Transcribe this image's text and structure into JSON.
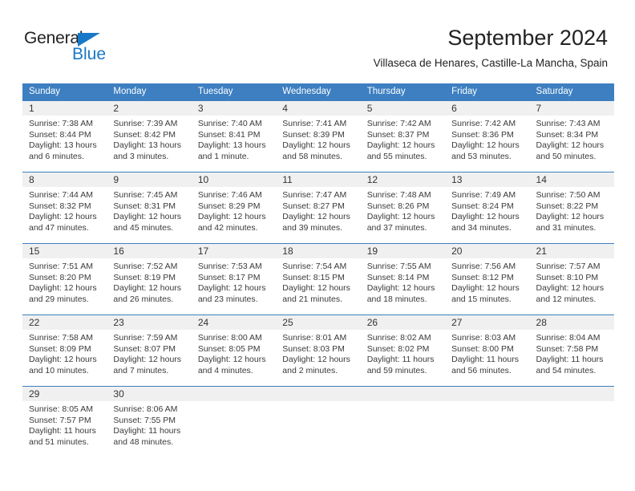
{
  "brand": {
    "name_part1": "General",
    "name_part2": "Blue",
    "triangle_color": "#1878c8",
    "text_color": "#222222"
  },
  "header": {
    "month_title": "September 2024",
    "location": "Villaseca de Henares, Castille-La Mancha, Spain"
  },
  "theme": {
    "header_blue": "#3d7fc1",
    "daynum_background": "#f0f0f0",
    "cell_text": "#3a3a3a"
  },
  "calendar": {
    "weekday_headers": [
      "Sunday",
      "Monday",
      "Tuesday",
      "Wednesday",
      "Thursday",
      "Friday",
      "Saturday"
    ],
    "weeks": [
      [
        {
          "day": "1",
          "sunrise": "Sunrise: 7:38 AM",
          "sunset": "Sunset: 8:44 PM",
          "daylight1": "Daylight: 13 hours",
          "daylight2": "and 6 minutes."
        },
        {
          "day": "2",
          "sunrise": "Sunrise: 7:39 AM",
          "sunset": "Sunset: 8:42 PM",
          "daylight1": "Daylight: 13 hours",
          "daylight2": "and 3 minutes."
        },
        {
          "day": "3",
          "sunrise": "Sunrise: 7:40 AM",
          "sunset": "Sunset: 8:41 PM",
          "daylight1": "Daylight: 13 hours",
          "daylight2": "and 1 minute."
        },
        {
          "day": "4",
          "sunrise": "Sunrise: 7:41 AM",
          "sunset": "Sunset: 8:39 PM",
          "daylight1": "Daylight: 12 hours",
          "daylight2": "and 58 minutes."
        },
        {
          "day": "5",
          "sunrise": "Sunrise: 7:42 AM",
          "sunset": "Sunset: 8:37 PM",
          "daylight1": "Daylight: 12 hours",
          "daylight2": "and 55 minutes."
        },
        {
          "day": "6",
          "sunrise": "Sunrise: 7:42 AM",
          "sunset": "Sunset: 8:36 PM",
          "daylight1": "Daylight: 12 hours",
          "daylight2": "and 53 minutes."
        },
        {
          "day": "7",
          "sunrise": "Sunrise: 7:43 AM",
          "sunset": "Sunset: 8:34 PM",
          "daylight1": "Daylight: 12 hours",
          "daylight2": "and 50 minutes."
        }
      ],
      [
        {
          "day": "8",
          "sunrise": "Sunrise: 7:44 AM",
          "sunset": "Sunset: 8:32 PM",
          "daylight1": "Daylight: 12 hours",
          "daylight2": "and 47 minutes."
        },
        {
          "day": "9",
          "sunrise": "Sunrise: 7:45 AM",
          "sunset": "Sunset: 8:31 PM",
          "daylight1": "Daylight: 12 hours",
          "daylight2": "and 45 minutes."
        },
        {
          "day": "10",
          "sunrise": "Sunrise: 7:46 AM",
          "sunset": "Sunset: 8:29 PM",
          "daylight1": "Daylight: 12 hours",
          "daylight2": "and 42 minutes."
        },
        {
          "day": "11",
          "sunrise": "Sunrise: 7:47 AM",
          "sunset": "Sunset: 8:27 PM",
          "daylight1": "Daylight: 12 hours",
          "daylight2": "and 39 minutes."
        },
        {
          "day": "12",
          "sunrise": "Sunrise: 7:48 AM",
          "sunset": "Sunset: 8:26 PM",
          "daylight1": "Daylight: 12 hours",
          "daylight2": "and 37 minutes."
        },
        {
          "day": "13",
          "sunrise": "Sunrise: 7:49 AM",
          "sunset": "Sunset: 8:24 PM",
          "daylight1": "Daylight: 12 hours",
          "daylight2": "and 34 minutes."
        },
        {
          "day": "14",
          "sunrise": "Sunrise: 7:50 AM",
          "sunset": "Sunset: 8:22 PM",
          "daylight1": "Daylight: 12 hours",
          "daylight2": "and 31 minutes."
        }
      ],
      [
        {
          "day": "15",
          "sunrise": "Sunrise: 7:51 AM",
          "sunset": "Sunset: 8:20 PM",
          "daylight1": "Daylight: 12 hours",
          "daylight2": "and 29 minutes."
        },
        {
          "day": "16",
          "sunrise": "Sunrise: 7:52 AM",
          "sunset": "Sunset: 8:19 PM",
          "daylight1": "Daylight: 12 hours",
          "daylight2": "and 26 minutes."
        },
        {
          "day": "17",
          "sunrise": "Sunrise: 7:53 AM",
          "sunset": "Sunset: 8:17 PM",
          "daylight1": "Daylight: 12 hours",
          "daylight2": "and 23 minutes."
        },
        {
          "day": "18",
          "sunrise": "Sunrise: 7:54 AM",
          "sunset": "Sunset: 8:15 PM",
          "daylight1": "Daylight: 12 hours",
          "daylight2": "and 21 minutes."
        },
        {
          "day": "19",
          "sunrise": "Sunrise: 7:55 AM",
          "sunset": "Sunset: 8:14 PM",
          "daylight1": "Daylight: 12 hours",
          "daylight2": "and 18 minutes."
        },
        {
          "day": "20",
          "sunrise": "Sunrise: 7:56 AM",
          "sunset": "Sunset: 8:12 PM",
          "daylight1": "Daylight: 12 hours",
          "daylight2": "and 15 minutes."
        },
        {
          "day": "21",
          "sunrise": "Sunrise: 7:57 AM",
          "sunset": "Sunset: 8:10 PM",
          "daylight1": "Daylight: 12 hours",
          "daylight2": "and 12 minutes."
        }
      ],
      [
        {
          "day": "22",
          "sunrise": "Sunrise: 7:58 AM",
          "sunset": "Sunset: 8:09 PM",
          "daylight1": "Daylight: 12 hours",
          "daylight2": "and 10 minutes."
        },
        {
          "day": "23",
          "sunrise": "Sunrise: 7:59 AM",
          "sunset": "Sunset: 8:07 PM",
          "daylight1": "Daylight: 12 hours",
          "daylight2": "and 7 minutes."
        },
        {
          "day": "24",
          "sunrise": "Sunrise: 8:00 AM",
          "sunset": "Sunset: 8:05 PM",
          "daylight1": "Daylight: 12 hours",
          "daylight2": "and 4 minutes."
        },
        {
          "day": "25",
          "sunrise": "Sunrise: 8:01 AM",
          "sunset": "Sunset: 8:03 PM",
          "daylight1": "Daylight: 12 hours",
          "daylight2": "and 2 minutes."
        },
        {
          "day": "26",
          "sunrise": "Sunrise: 8:02 AM",
          "sunset": "Sunset: 8:02 PM",
          "daylight1": "Daylight: 11 hours",
          "daylight2": "and 59 minutes."
        },
        {
          "day": "27",
          "sunrise": "Sunrise: 8:03 AM",
          "sunset": "Sunset: 8:00 PM",
          "daylight1": "Daylight: 11 hours",
          "daylight2": "and 56 minutes."
        },
        {
          "day": "28",
          "sunrise": "Sunrise: 8:04 AM",
          "sunset": "Sunset: 7:58 PM",
          "daylight1": "Daylight: 11 hours",
          "daylight2": "and 54 minutes."
        }
      ],
      [
        {
          "day": "29",
          "sunrise": "Sunrise: 8:05 AM",
          "sunset": "Sunset: 7:57 PM",
          "daylight1": "Daylight: 11 hours",
          "daylight2": "and 51 minutes."
        },
        {
          "day": "30",
          "sunrise": "Sunrise: 8:06 AM",
          "sunset": "Sunset: 7:55 PM",
          "daylight1": "Daylight: 11 hours",
          "daylight2": "and 48 minutes."
        },
        {
          "day": "",
          "sunrise": "",
          "sunset": "",
          "daylight1": "",
          "daylight2": ""
        },
        {
          "day": "",
          "sunrise": "",
          "sunset": "",
          "daylight1": "",
          "daylight2": ""
        },
        {
          "day": "",
          "sunrise": "",
          "sunset": "",
          "daylight1": "",
          "daylight2": ""
        },
        {
          "day": "",
          "sunrise": "",
          "sunset": "",
          "daylight1": "",
          "daylight2": ""
        },
        {
          "day": "",
          "sunrise": "",
          "sunset": "",
          "daylight1": "",
          "daylight2": ""
        }
      ]
    ]
  }
}
